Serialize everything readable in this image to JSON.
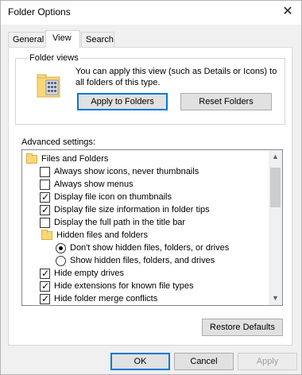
{
  "window": {
    "title": "Folder Options"
  },
  "tabs": [
    {
      "label": "General",
      "active": false
    },
    {
      "label": "View",
      "active": true
    },
    {
      "label": "Search",
      "active": false
    }
  ],
  "folder_views": {
    "label": "Folder views",
    "description": "You can apply this view (such as Details or Icons) to all folders of this type.",
    "apply_button": "Apply to Folders",
    "reset_button": "Reset Folders"
  },
  "advanced": {
    "label": "Advanced settings:",
    "items": [
      {
        "type": "folder",
        "text": "Files and Folders"
      },
      {
        "type": "checkbox",
        "text": "Always show icons, never thumbnails",
        "checked": false
      },
      {
        "type": "checkbox",
        "text": "Always show menus",
        "checked": false
      },
      {
        "type": "checkbox",
        "text": "Display file icon on thumbnails",
        "checked": true
      },
      {
        "type": "checkbox",
        "text": "Display file size information in folder tips",
        "checked": true
      },
      {
        "type": "checkbox",
        "text": "Display the full path in the title bar",
        "checked": false
      },
      {
        "type": "folder",
        "text": "Hidden files and folders"
      },
      {
        "type": "radio",
        "text": "Don't show hidden files, folders, or drives",
        "checked": true
      },
      {
        "type": "radio",
        "text": "Show hidden files, folders, and drives",
        "checked": false
      },
      {
        "type": "checkbox",
        "text": "Hide empty drives",
        "checked": true
      },
      {
        "type": "checkbox",
        "text": "Hide extensions for known file types",
        "checked": true
      },
      {
        "type": "checkbox",
        "text": "Hide folder merge conflicts",
        "checked": true
      }
    ]
  },
  "buttons": {
    "restore_defaults": "Restore Defaults",
    "ok": "OK",
    "cancel": "Cancel",
    "apply": "Apply"
  },
  "icons": {
    "close": "close-icon",
    "folder_views": "folder-grid-icon",
    "checkmark": "✓"
  },
  "colors": {
    "accent": "#0078d7",
    "folder": "#f8d775",
    "disabled_text": "#a0a0a0"
  }
}
